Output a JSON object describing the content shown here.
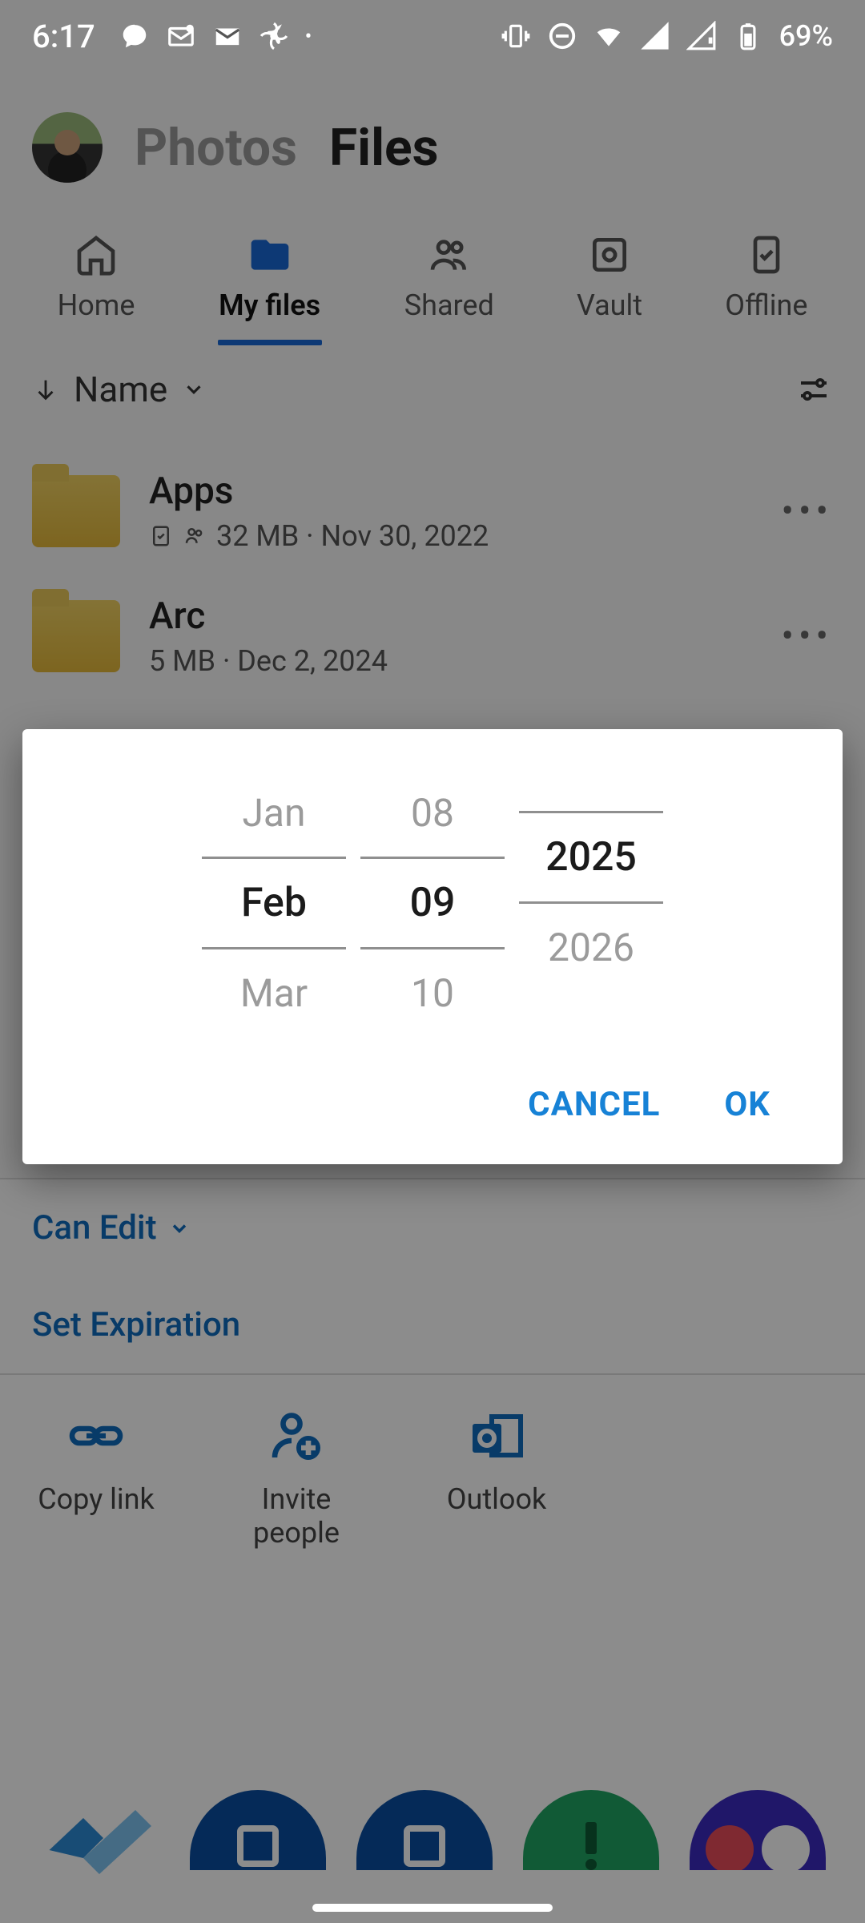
{
  "status": {
    "time": "6:17",
    "battery": "69%"
  },
  "header": {
    "photos": "Photos",
    "files": "Files"
  },
  "tabs": {
    "home": {
      "label": "Home"
    },
    "myfiles": {
      "label": "My files"
    },
    "shared": {
      "label": "Shared"
    },
    "vault": {
      "label": "Vault"
    },
    "offline": {
      "label": "Offline"
    }
  },
  "sort": {
    "label": "Name"
  },
  "folders": [
    {
      "name": "Apps",
      "meta": "32 MB · Nov 30, 2022"
    },
    {
      "name": "Arc",
      "meta": "5 MB · Dec 2, 2024"
    }
  ],
  "share": {
    "permission": "Can Edit",
    "expiration_label": "Set Expiration",
    "targets": {
      "copy": "Copy link",
      "invite": "Invite people",
      "outlook": "Outlook"
    }
  },
  "date_picker": {
    "month": {
      "prev": "Jan",
      "sel": "Feb",
      "next": "Mar"
    },
    "day": {
      "prev": "08",
      "sel": "09",
      "next": "10"
    },
    "year": {
      "prev": "",
      "sel": "2025",
      "next": "2026"
    },
    "cancel": "CANCEL",
    "ok": "OK"
  }
}
